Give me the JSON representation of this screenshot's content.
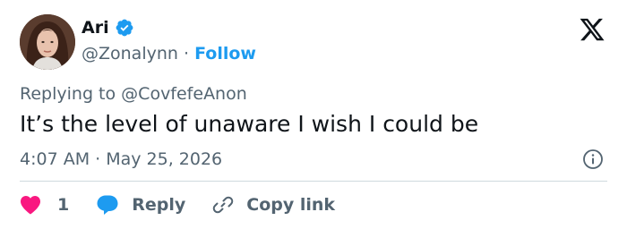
{
  "author": {
    "display_name": "Ari",
    "handle": "@Zonalynn",
    "separator": "·",
    "follow_label": "Follow",
    "verified": true,
    "avatar_icon": "avatar-photo"
  },
  "logo": "x-logo-icon",
  "reply_context": {
    "prefix": "Replying to",
    "target_handle": "@CovfefeAnon"
  },
  "tweet": {
    "text": "It’s the level of unaware I wish I could be",
    "timestamp": "4:07 AM · May 25, 2026"
  },
  "actions": {
    "like_count": "1",
    "reply_label": "Reply",
    "copy_link_label": "Copy link"
  },
  "colors": {
    "accent": "#1d9bf0",
    "like": "#f91880",
    "text_primary": "#0f1419",
    "text_secondary": "#536471",
    "divider": "#cfd9de"
  }
}
